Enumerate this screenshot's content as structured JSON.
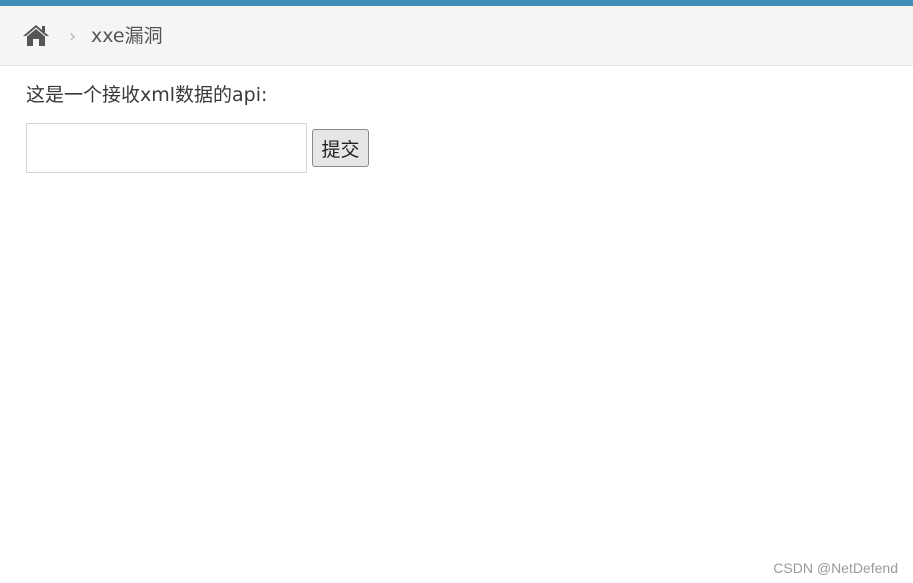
{
  "breadcrumb": {
    "home_icon": "home-icon",
    "separator": "›",
    "current": "xxe漏洞"
  },
  "main": {
    "description": "这是一个接收xml数据的api:",
    "input_value": "",
    "submit_label": "提交"
  },
  "watermark": "CSDN @NetDefend",
  "colors": {
    "accent": "#438eb9",
    "breadcrumb_bg": "#f5f5f5",
    "icon": "#555555"
  }
}
